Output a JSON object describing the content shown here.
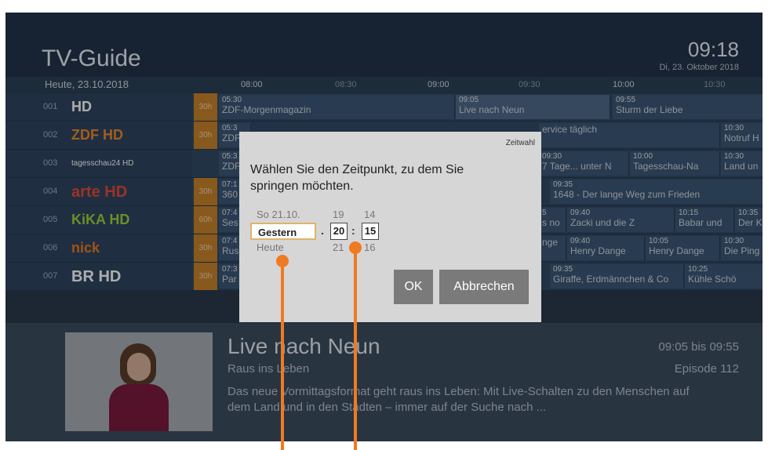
{
  "header": {
    "title": "TV-Guide",
    "clock": "09:18",
    "date": "Di, 23. Oktober 2018"
  },
  "timeline": {
    "day": "Heute, 23.10.2018",
    "ticks": [
      "08:00",
      "08:30",
      "09:00",
      "09:30",
      "10:00",
      "10:30"
    ]
  },
  "channels": [
    {
      "num": "001",
      "logo": "HD",
      "tag": "30h",
      "programs": [
        {
          "time": "05:30",
          "title": "ZDF-Morgenmagazin"
        },
        {
          "time": "09:05",
          "title": "Live nach Neun"
        },
        {
          "time": "09:55",
          "title": "Sturm der Liebe"
        }
      ]
    },
    {
      "num": "002",
      "logo": "ZDF HD",
      "tag": "30h",
      "programs": [
        {
          "time": "05:3",
          "title": "ZDF"
        },
        {
          "time": "",
          "title": "ervice täglich"
        },
        {
          "time": "10:30",
          "title": "Notruf H"
        }
      ]
    },
    {
      "num": "003",
      "logo": "tagesschau24 HD",
      "tag": "",
      "programs": [
        {
          "time": "05:3",
          "title": "ZDF"
        },
        {
          "time": "09:30",
          "title": "7 Tage... unter N"
        },
        {
          "time": "10:00",
          "title": "Tagesschau-Na"
        },
        {
          "time": "10:30",
          "title": "Land un"
        }
      ]
    },
    {
      "num": "004",
      "logo": "arte HD",
      "tag": "30h",
      "programs": [
        {
          "time": "07:1",
          "title": "360"
        },
        {
          "time": "09:35",
          "title": "1648 - Der lange Weg zum Frieden"
        }
      ]
    },
    {
      "num": "005",
      "logo": "KiKA HD",
      "tag": "60h",
      "programs": [
        {
          "time": "07:4",
          "title": "Ses"
        },
        {
          "time": "5",
          "title": "s no"
        },
        {
          "time": "09:40",
          "title": "Zacki und die Z"
        },
        {
          "time": "10:15",
          "title": "Babar und"
        },
        {
          "time": "10:35",
          "title": "Der K"
        }
      ]
    },
    {
      "num": "006",
      "logo": "nick",
      "tag": "30h",
      "programs": [
        {
          "time": "07:4",
          "title": "Rus"
        },
        {
          "time": "",
          "title": "nge"
        },
        {
          "time": "09:40",
          "title": "Henry Dange"
        },
        {
          "time": "10:05",
          "title": "Henry Dange"
        },
        {
          "time": "10:30",
          "title": "Die Ping"
        }
      ]
    },
    {
      "num": "007",
      "logo": "BR HD",
      "tag": "30h",
      "programs": [
        {
          "time": "07:3",
          "title": "Par"
        },
        {
          "time": "09:35",
          "title": "Giraffe, Erdmännchen & Co"
        },
        {
          "time": "10:25",
          "title": "Kühle Schö"
        }
      ]
    }
  ],
  "info": {
    "title": "Live nach Neun",
    "subtitle": "Raus ins Leben",
    "description": "Das neue Vormittagsformat geht raus ins Leben: Mit Live-Schalten zu den Menschen auf dem Land und in den Städten – immer auf der Suche nach ...",
    "time": "09:05 bis 09:55",
    "episode": "Episode 112"
  },
  "dialog": {
    "label": "Zeitwahl",
    "text": "Wählen Sie den Zeitpunkt, zu dem Sie springen möchten.",
    "day_prev": "So 21.10.",
    "day_current": "Gestern",
    "day_next": "Heute",
    "hour_prev": "19",
    "hour_current": "20",
    "hour_next": "21",
    "minute_prev": "14",
    "minute_current": "15",
    "minute_next": "16",
    "separator_day": ".",
    "separator_time": ":",
    "ok_label": "OK",
    "cancel_label": "Abbrechen"
  },
  "colors": {
    "accent": "#ef7a22",
    "background": "#2a3a4c",
    "tag": "#c8842c"
  }
}
